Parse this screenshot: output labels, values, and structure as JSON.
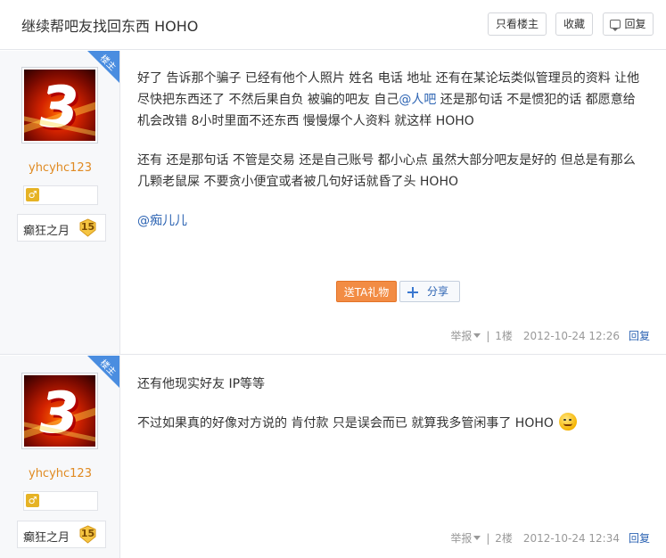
{
  "header": {
    "title": "继续帮吧友找回东西 HOHO",
    "only_op_label": "只看楼主",
    "favorite_label": "收藏",
    "reply_label": "回复"
  },
  "colors": {
    "accent_link": "#2d64b3",
    "username": "#e08a22",
    "gift_button": "#f28c44",
    "corner_tag": "#4a8de0",
    "level_badge": "#f5c542"
  },
  "posts": [
    {
      "corner_tag": "楼主",
      "username": "yhcyhc123",
      "gender_icon": "♂",
      "level_title": "癫狂之月",
      "level_number": "15",
      "paragraphs": [
        {
          "before": "好了 告诉那个骗子 已经有他个人照片 姓名 电话 地址 还有在某论坛类似管理员的资料 让他尽快把东西还了 不然后果自负 被骗的吧友 自己",
          "mention": "@人吧",
          "after": " 还是那句话 不是惯犯的话 都愿意给机会改错 8小时里面不还东西 慢慢爆个人资料 就这样 HOHO"
        },
        {
          "text": "还有 还是那句话 不管是交易 还是自己账号 都小心点 虽然大部分吧友是好的 但总是有那么几颗老鼠屎 不要贪小便宜或者被几句好话就昏了头 HOHO"
        },
        {
          "mention_only": "@痴儿儿"
        }
      ],
      "gift_label": "送TA礼物",
      "share_label": "分享",
      "report_label": "举报",
      "floor": "1楼",
      "time": "2012-10-24 12:26",
      "reply_label": "回复"
    },
    {
      "corner_tag": "楼主",
      "username": "yhcyhc123",
      "gender_icon": "♂",
      "level_title": "癫狂之月",
      "level_number": "15",
      "paragraphs": [
        {
          "text": "还有他现实好友 IP等等"
        },
        {
          "text": "不过如果真的好像对方说的 肯付款 只是误会而已 就算我多管闲事了 HOHO"
        }
      ],
      "emoji": "smirk-emoji",
      "report_label": "举报",
      "floor": "2楼",
      "time": "2012-10-24 12:34",
      "reply_label": "回复"
    }
  ]
}
